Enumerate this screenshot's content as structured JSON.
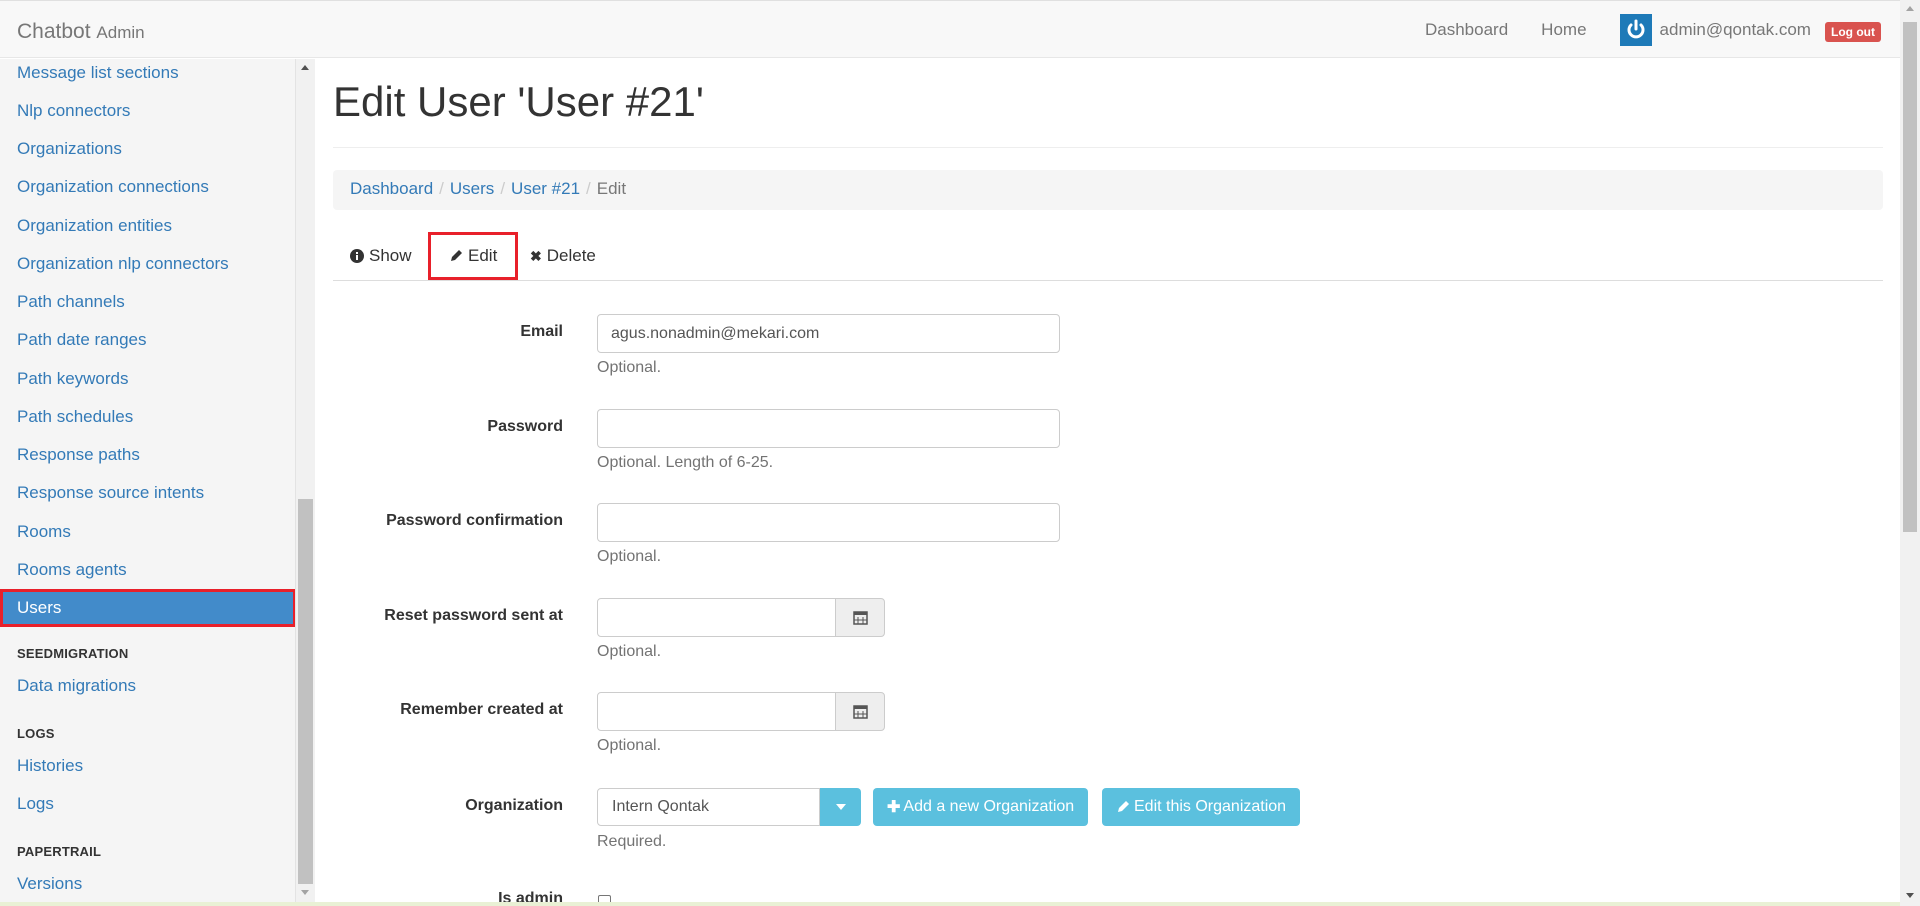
{
  "navbar": {
    "brand": "Chatbot",
    "brand_sub": "Admin",
    "links": [
      "Dashboard",
      "Home"
    ],
    "user_email": "admin@qontak.com",
    "logout_label": "Log out"
  },
  "sidebar": {
    "items": [
      "Message list sections",
      "Nlp connectors",
      "Organizations",
      "Organization connections",
      "Organization entities",
      "Organization nlp connectors",
      "Path channels",
      "Path date ranges",
      "Path keywords",
      "Path schedules",
      "Response paths",
      "Response source intents",
      "Rooms",
      "Rooms agents"
    ],
    "active_item": "Users",
    "sections": [
      {
        "heading": "SEEDMIGRATION",
        "items": [
          "Data migrations"
        ]
      },
      {
        "heading": "LOGS",
        "items": [
          "Histories",
          "Logs"
        ]
      },
      {
        "heading": "PAPERTRAIL",
        "items": [
          "Versions"
        ]
      }
    ]
  },
  "page": {
    "title": "Edit User 'User #21'",
    "breadcrumb": {
      "links": [
        "Dashboard",
        "Users",
        "User #21"
      ],
      "current": "Edit",
      "separator": "/"
    },
    "tabs": {
      "show": "Show",
      "edit": "Edit",
      "delete": "Delete"
    }
  },
  "form": {
    "email": {
      "label": "Email",
      "value": "agus.nonadmin@mekari.com",
      "help": "Optional."
    },
    "password": {
      "label": "Password",
      "value": "",
      "help": "Optional. Length of 6-25."
    },
    "password_confirmation": {
      "label": "Password confirmation",
      "value": "",
      "help": "Optional."
    },
    "reset_password_sent_at": {
      "label": "Reset password sent at",
      "value": "",
      "help": "Optional."
    },
    "remember_created_at": {
      "label": "Remember created at",
      "value": "",
      "help": "Optional."
    },
    "organization": {
      "label": "Organization",
      "selected": "Intern Qontak",
      "help": "Required.",
      "add_label": "Add a new Organization",
      "edit_label": "Edit this Organization"
    },
    "is_admin": {
      "label": "Is admin",
      "checked": false
    }
  },
  "colors": {
    "link": "#337ab7",
    "active_bg": "#428bca",
    "highlight_border": "#e8202a",
    "info": "#5bc0de",
    "danger": "#d9534f"
  }
}
